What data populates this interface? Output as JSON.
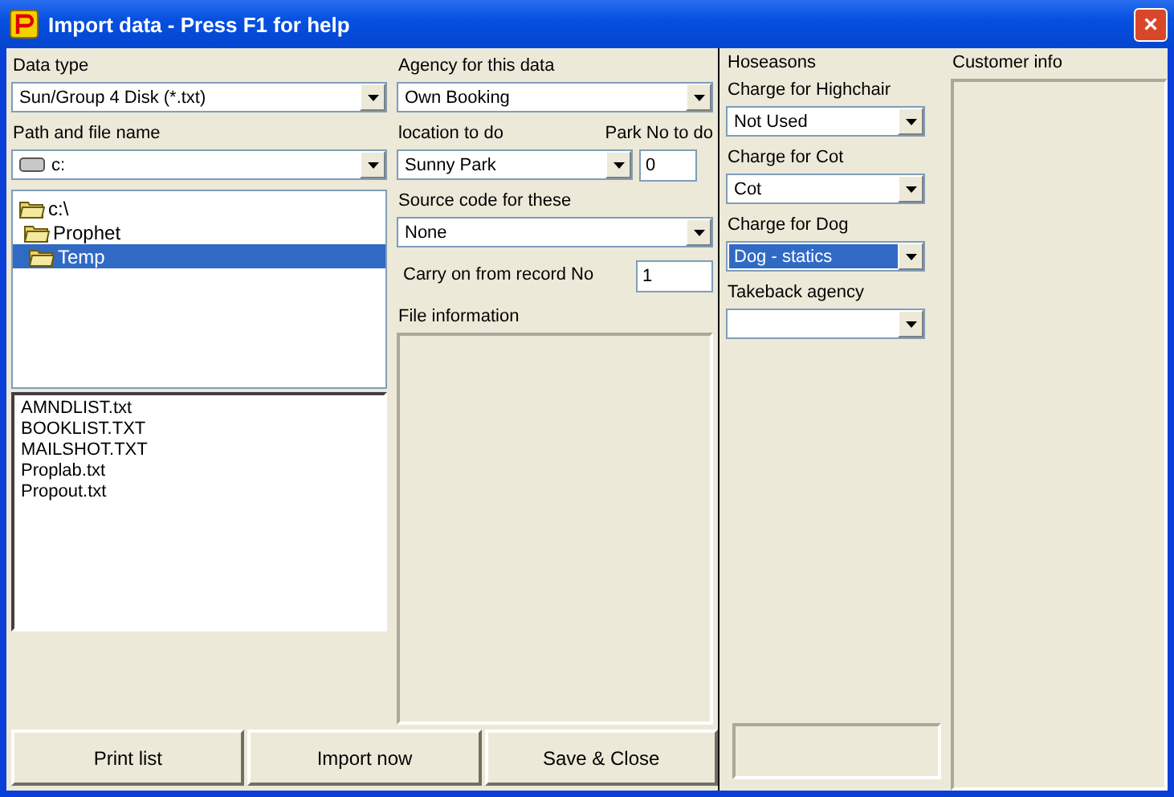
{
  "window": {
    "title": "Import data - Press F1 for help",
    "close": "×"
  },
  "data_type": {
    "label": "Data type",
    "value": "Sun/Group 4 Disk (*.txt)"
  },
  "path": {
    "label": "Path and file name",
    "value": "c:"
  },
  "folders": [
    {
      "name": "c:\\",
      "selected": false,
      "children": [
        {
          "name": "Prophet",
          "selected": false,
          "children": [
            {
              "name": "Temp",
              "selected": true
            }
          ]
        }
      ]
    }
  ],
  "files": [
    "AMNDLIST.txt",
    "BOOKLIST.TXT",
    "MAILSHOT.TXT",
    "Proplab.txt",
    "Propout.txt"
  ],
  "agency": {
    "label": "Agency for this data",
    "value": "Own Booking"
  },
  "location": {
    "label": "location to do",
    "value": "Sunny Park"
  },
  "park_no": {
    "label": "Park No to do",
    "value": "0"
  },
  "source_code": {
    "label": "Source code for these",
    "value": "None"
  },
  "carry_on": {
    "label": "Carry on from record No",
    "value": "1"
  },
  "file_information": {
    "label": "File information"
  },
  "buttons": [
    "Print list",
    "Import now",
    "Save & Close"
  ],
  "hoseasons": {
    "heading": "Hoseasons",
    "fields": [
      {
        "label": "Charge for Highchair",
        "value": "Not Used",
        "selected": false
      },
      {
        "label": "Charge for Cot",
        "value": "Cot",
        "selected": false
      },
      {
        "label": "Charge for Dog",
        "value": "Dog - statics",
        "selected": true
      },
      {
        "label": "Takeback agency",
        "selected": false
      }
    ]
  },
  "customer_info": {
    "label": "Customer info"
  }
}
